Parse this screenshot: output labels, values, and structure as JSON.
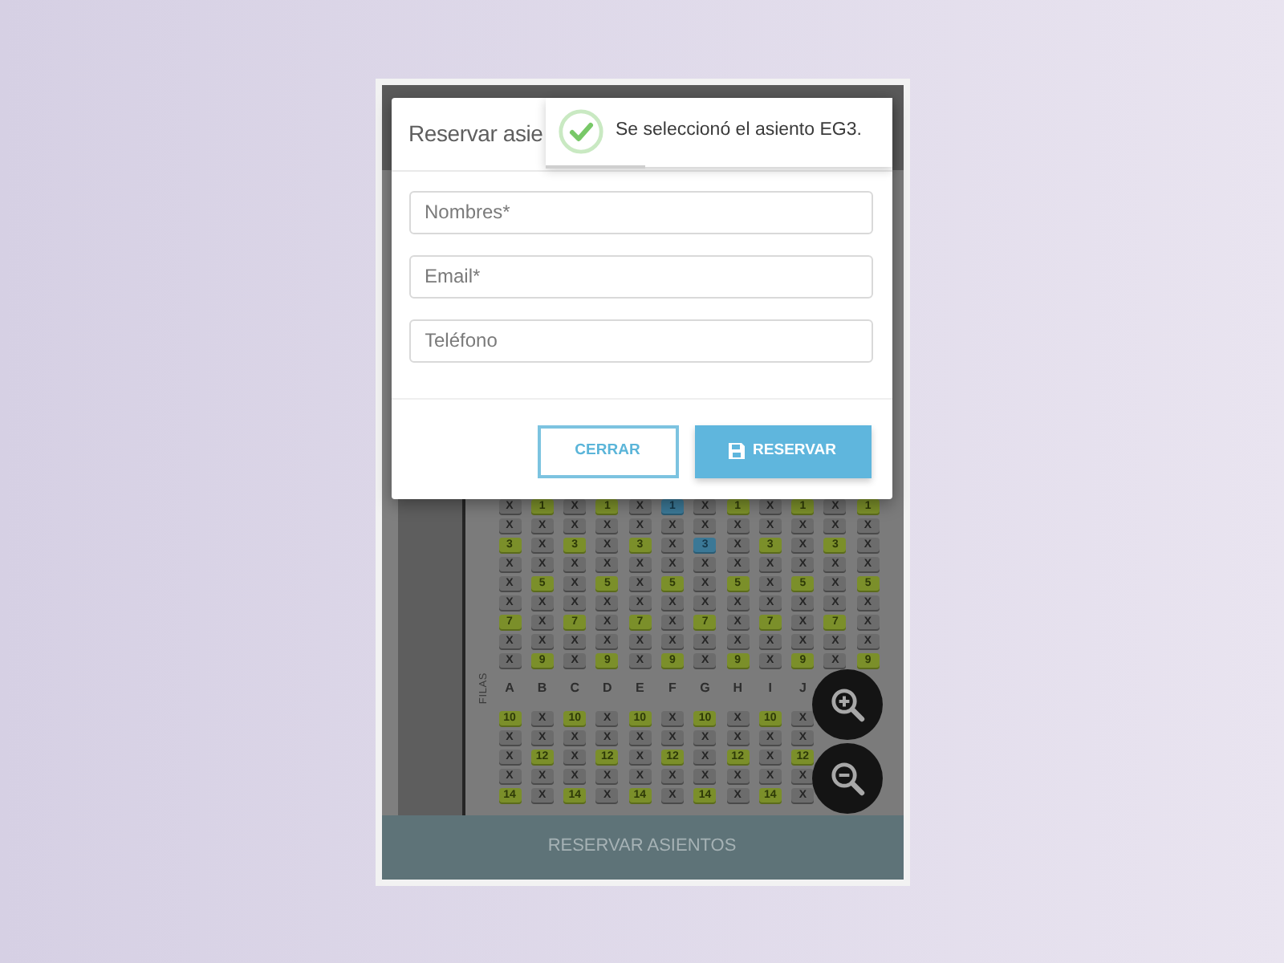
{
  "modal": {
    "title": "Reservar asie",
    "fields": [
      {
        "placeholder": "Nombres*"
      },
      {
        "placeholder": "Email*"
      },
      {
        "placeholder": "Teléfono"
      }
    ],
    "buttons": [
      {
        "label": "CERRAR",
        "kind": "outline"
      },
      {
        "label": "RESERVAR",
        "kind": "primary"
      }
    ]
  },
  "toast": {
    "message": "Se seleccionó el asiento EG3.",
    "level": 0.29
  },
  "seat_map": {
    "row_axis_label": "FILAS",
    "columns": [
      "A",
      "B",
      "C",
      "D",
      "E",
      "F",
      "G",
      "H",
      "I",
      "J"
    ],
    "upper_rows": [
      [
        {
          "label": "X",
          "kind": "taken",
          "selected": false
        },
        {
          "label": "1",
          "kind": "free",
          "selected": false
        },
        {
          "label": "X",
          "kind": "taken",
          "selected": false
        },
        {
          "label": "1",
          "kind": "free",
          "selected": false
        },
        {
          "label": "X",
          "kind": "taken",
          "selected": false
        },
        {
          "label": "1",
          "kind": "free",
          "selected": true
        },
        {
          "label": "X",
          "kind": "taken",
          "selected": false
        },
        {
          "label": "1",
          "kind": "free",
          "selected": false
        },
        {
          "label": "X",
          "kind": "taken",
          "selected": false
        },
        {
          "label": "1",
          "kind": "free",
          "selected": false
        },
        {
          "label": "X",
          "kind": "taken",
          "selected": false
        },
        {
          "label": "1",
          "kind": "free",
          "selected": false
        }
      ],
      [
        {
          "label": "X",
          "kind": "taken",
          "selected": false
        },
        {
          "label": "X",
          "kind": "taken",
          "selected": false
        },
        {
          "label": "X",
          "kind": "taken",
          "selected": false
        },
        {
          "label": "X",
          "kind": "taken",
          "selected": false
        },
        {
          "label": "X",
          "kind": "taken",
          "selected": false
        },
        {
          "label": "X",
          "kind": "taken",
          "selected": false
        },
        {
          "label": "X",
          "kind": "taken",
          "selected": false
        },
        {
          "label": "X",
          "kind": "taken",
          "selected": false
        },
        {
          "label": "X",
          "kind": "taken",
          "selected": false
        },
        {
          "label": "X",
          "kind": "taken",
          "selected": false
        },
        {
          "label": "X",
          "kind": "taken",
          "selected": false
        },
        {
          "label": "X",
          "kind": "taken",
          "selected": false
        }
      ],
      [
        {
          "label": "3",
          "kind": "free",
          "selected": false
        },
        {
          "label": "X",
          "kind": "taken",
          "selected": false
        },
        {
          "label": "3",
          "kind": "free",
          "selected": false
        },
        {
          "label": "X",
          "kind": "taken",
          "selected": false
        },
        {
          "label": "3",
          "kind": "free",
          "selected": false
        },
        {
          "label": "X",
          "kind": "taken",
          "selected": false
        },
        {
          "label": "3",
          "kind": "free",
          "selected": true
        },
        {
          "label": "X",
          "kind": "taken",
          "selected": false
        },
        {
          "label": "3",
          "kind": "free",
          "selected": false
        },
        {
          "label": "X",
          "kind": "taken",
          "selected": false
        },
        {
          "label": "3",
          "kind": "free",
          "selected": false
        },
        {
          "label": "X",
          "kind": "taken",
          "selected": false
        }
      ],
      [
        {
          "label": "X",
          "kind": "taken",
          "selected": false
        },
        {
          "label": "X",
          "kind": "taken",
          "selected": false
        },
        {
          "label": "X",
          "kind": "taken",
          "selected": false
        },
        {
          "label": "X",
          "kind": "taken",
          "selected": false
        },
        {
          "label": "X",
          "kind": "taken",
          "selected": false
        },
        {
          "label": "X",
          "kind": "taken",
          "selected": false
        },
        {
          "label": "X",
          "kind": "taken",
          "selected": false
        },
        {
          "label": "X",
          "kind": "taken",
          "selected": false
        },
        {
          "label": "X",
          "kind": "taken",
          "selected": false
        },
        {
          "label": "X",
          "kind": "taken",
          "selected": false
        },
        {
          "label": "X",
          "kind": "taken",
          "selected": false
        },
        {
          "label": "X",
          "kind": "taken",
          "selected": false
        }
      ],
      [
        {
          "label": "X",
          "kind": "taken",
          "selected": false
        },
        {
          "label": "5",
          "kind": "free",
          "selected": false
        },
        {
          "label": "X",
          "kind": "taken",
          "selected": false
        },
        {
          "label": "5",
          "kind": "free",
          "selected": false
        },
        {
          "label": "X",
          "kind": "taken",
          "selected": false
        },
        {
          "label": "5",
          "kind": "free",
          "selected": false
        },
        {
          "label": "X",
          "kind": "taken",
          "selected": false
        },
        {
          "label": "5",
          "kind": "free",
          "selected": false
        },
        {
          "label": "X",
          "kind": "taken",
          "selected": false
        },
        {
          "label": "5",
          "kind": "free",
          "selected": false
        },
        {
          "label": "X",
          "kind": "taken",
          "selected": false
        },
        {
          "label": "5",
          "kind": "free",
          "selected": false
        }
      ],
      [
        {
          "label": "X",
          "kind": "taken",
          "selected": false
        },
        {
          "label": "X",
          "kind": "taken",
          "selected": false
        },
        {
          "label": "X",
          "kind": "taken",
          "selected": false
        },
        {
          "label": "X",
          "kind": "taken",
          "selected": false
        },
        {
          "label": "X",
          "kind": "taken",
          "selected": false
        },
        {
          "label": "X",
          "kind": "taken",
          "selected": false
        },
        {
          "label": "X",
          "kind": "taken",
          "selected": false
        },
        {
          "label": "X",
          "kind": "taken",
          "selected": false
        },
        {
          "label": "X",
          "kind": "taken",
          "selected": false
        },
        {
          "label": "X",
          "kind": "taken",
          "selected": false
        },
        {
          "label": "X",
          "kind": "taken",
          "selected": false
        },
        {
          "label": "X",
          "kind": "taken",
          "selected": false
        }
      ],
      [
        {
          "label": "7",
          "kind": "free",
          "selected": false
        },
        {
          "label": "X",
          "kind": "taken",
          "selected": false
        },
        {
          "label": "7",
          "kind": "free",
          "selected": false
        },
        {
          "label": "X",
          "kind": "taken",
          "selected": false
        },
        {
          "label": "7",
          "kind": "free",
          "selected": false
        },
        {
          "label": "X",
          "kind": "taken",
          "selected": false
        },
        {
          "label": "7",
          "kind": "free",
          "selected": false
        },
        {
          "label": "X",
          "kind": "taken",
          "selected": false
        },
        {
          "label": "7",
          "kind": "free",
          "selected": false
        },
        {
          "label": "X",
          "kind": "taken",
          "selected": false
        },
        {
          "label": "7",
          "kind": "free",
          "selected": false
        },
        {
          "label": "X",
          "kind": "taken",
          "selected": false
        }
      ],
      [
        {
          "label": "X",
          "kind": "taken",
          "selected": false
        },
        {
          "label": "X",
          "kind": "taken",
          "selected": false
        },
        {
          "label": "X",
          "kind": "taken",
          "selected": false
        },
        {
          "label": "X",
          "kind": "taken",
          "selected": false
        },
        {
          "label": "X",
          "kind": "taken",
          "selected": false
        },
        {
          "label": "X",
          "kind": "taken",
          "selected": false
        },
        {
          "label": "X",
          "kind": "taken",
          "selected": false
        },
        {
          "label": "X",
          "kind": "taken",
          "selected": false
        },
        {
          "label": "X",
          "kind": "taken",
          "selected": false
        },
        {
          "label": "X",
          "kind": "taken",
          "selected": false
        },
        {
          "label": "X",
          "kind": "taken",
          "selected": false
        },
        {
          "label": "X",
          "kind": "taken",
          "selected": false
        }
      ],
      [
        {
          "label": "X",
          "kind": "taken",
          "selected": false
        },
        {
          "label": "9",
          "kind": "free",
          "selected": false
        },
        {
          "label": "X",
          "kind": "taken",
          "selected": false
        },
        {
          "label": "9",
          "kind": "free",
          "selected": false
        },
        {
          "label": "X",
          "kind": "taken",
          "selected": false
        },
        {
          "label": "9",
          "kind": "free",
          "selected": false
        },
        {
          "label": "X",
          "kind": "taken",
          "selected": false
        },
        {
          "label": "9",
          "kind": "free",
          "selected": false
        },
        {
          "label": "X",
          "kind": "taken",
          "selected": false
        },
        {
          "label": "9",
          "kind": "free",
          "selected": false
        },
        {
          "label": "X",
          "kind": "taken",
          "selected": false
        },
        {
          "label": "9",
          "kind": "free",
          "selected": false
        }
      ]
    ],
    "lower_rows": [
      [
        {
          "label": "10",
          "kind": "free",
          "selected": false
        },
        {
          "label": "X",
          "kind": "taken",
          "selected": false
        },
        {
          "label": "10",
          "kind": "free",
          "selected": false
        },
        {
          "label": "X",
          "kind": "taken",
          "selected": false
        },
        {
          "label": "10",
          "kind": "free",
          "selected": false
        },
        {
          "label": "X",
          "kind": "taken",
          "selected": false
        },
        {
          "label": "10",
          "kind": "free",
          "selected": false
        },
        {
          "label": "X",
          "kind": "taken",
          "selected": false
        },
        {
          "label": "10",
          "kind": "free",
          "selected": false
        },
        {
          "label": "X",
          "kind": "taken",
          "selected": false
        }
      ],
      [
        {
          "label": "X",
          "kind": "taken",
          "selected": false
        },
        {
          "label": "X",
          "kind": "taken",
          "selected": false
        },
        {
          "label": "X",
          "kind": "taken",
          "selected": false
        },
        {
          "label": "X",
          "kind": "taken",
          "selected": false
        },
        {
          "label": "X",
          "kind": "taken",
          "selected": false
        },
        {
          "label": "X",
          "kind": "taken",
          "selected": false
        },
        {
          "label": "X",
          "kind": "taken",
          "selected": false
        },
        {
          "label": "X",
          "kind": "taken",
          "selected": false
        },
        {
          "label": "X",
          "kind": "taken",
          "selected": false
        },
        {
          "label": "X",
          "kind": "taken",
          "selected": false
        }
      ],
      [
        {
          "label": "X",
          "kind": "taken",
          "selected": false
        },
        {
          "label": "12",
          "kind": "free",
          "selected": false
        },
        {
          "label": "X",
          "kind": "taken",
          "selected": false
        },
        {
          "label": "12",
          "kind": "free",
          "selected": false
        },
        {
          "label": "X",
          "kind": "taken",
          "selected": false
        },
        {
          "label": "12",
          "kind": "free",
          "selected": false
        },
        {
          "label": "X",
          "kind": "taken",
          "selected": false
        },
        {
          "label": "12",
          "kind": "free",
          "selected": false
        },
        {
          "label": "X",
          "kind": "taken",
          "selected": false
        },
        {
          "label": "12",
          "kind": "free",
          "selected": false
        }
      ],
      [
        {
          "label": "X",
          "kind": "taken",
          "selected": false
        },
        {
          "label": "X",
          "kind": "taken",
          "selected": false
        },
        {
          "label": "X",
          "kind": "taken",
          "selected": false
        },
        {
          "label": "X",
          "kind": "taken",
          "selected": false
        },
        {
          "label": "X",
          "kind": "taken",
          "selected": false
        },
        {
          "label": "X",
          "kind": "taken",
          "selected": false
        },
        {
          "label": "X",
          "kind": "taken",
          "selected": false
        },
        {
          "label": "X",
          "kind": "taken",
          "selected": false
        },
        {
          "label": "X",
          "kind": "taken",
          "selected": false
        },
        {
          "label": "X",
          "kind": "taken",
          "selected": false
        }
      ],
      [
        {
          "label": "14",
          "kind": "free",
          "selected": false
        },
        {
          "label": "X",
          "kind": "taken",
          "selected": false
        },
        {
          "label": "14",
          "kind": "free",
          "selected": false
        },
        {
          "label": "X",
          "kind": "taken",
          "selected": false
        },
        {
          "label": "14",
          "kind": "free",
          "selected": false
        },
        {
          "label": "X",
          "kind": "taken",
          "selected": false
        },
        {
          "label": "14",
          "kind": "free",
          "selected": false
        },
        {
          "label": "X",
          "kind": "taken",
          "selected": false
        },
        {
          "label": "14",
          "kind": "free",
          "selected": false
        },
        {
          "label": "X",
          "kind": "taken",
          "selected": false
        }
      ]
    ]
  },
  "bottom_bar": {
    "label": "RESERVAR ASIENTOS"
  }
}
